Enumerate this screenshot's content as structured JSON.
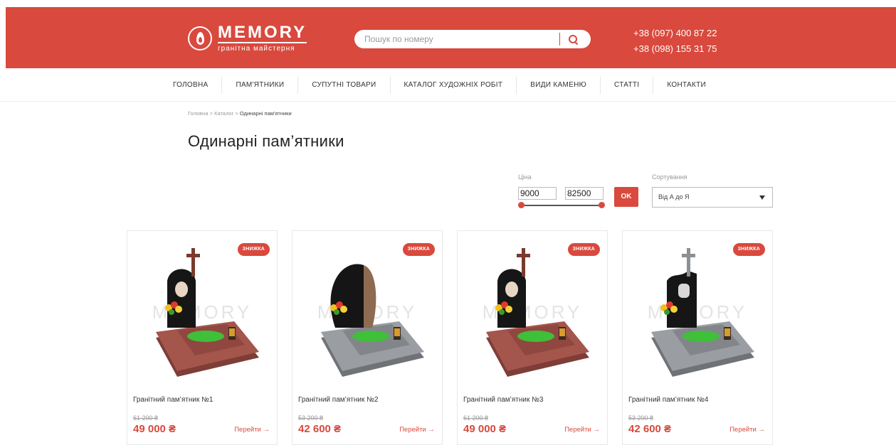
{
  "header": {
    "logo_name": "MEMORY",
    "logo_sub": "гранітна майстерня",
    "search_placeholder": "Пошук по номеру",
    "phones": [
      "+38 (097) 400 87 22",
      "+38 (098) 155 31 75"
    ]
  },
  "nav": [
    "ГОЛОВНА",
    "ПАМ'ЯТНИКИ",
    "СУПУТНІ ТОВАРИ",
    "КАТАЛОГ ХУДОЖНІХ РОБІТ",
    "ВИДИ КАМЕНЮ",
    "СТАТТІ",
    "КОНТАКТИ"
  ],
  "breadcrumb": {
    "items": [
      "Головна",
      "Каталог",
      "Одинарні пам'ятники"
    ],
    "separator": ">"
  },
  "page_title": "Одинарні пам’ятники",
  "filter": {
    "price_label": "Ціна",
    "price_min": "9000",
    "price_max": "82500",
    "ok_label": "OK",
    "sort_label": "Сортування",
    "sort_value": "Від А до Я"
  },
  "products": [
    {
      "title": "Гранітний пам’ятник №1",
      "badge": "ЗНИЖКА",
      "old_price": "61 200 ₴",
      "new_price": "49 000 ₴",
      "link": "Перейти →",
      "style": "red-cross"
    },
    {
      "title": "Гранітний пам’ятник №2",
      "badge": "ЗНИЖКА",
      "old_price": "53 200 ₴",
      "new_price": "42 600 ₴",
      "link": "Перейти →",
      "style": "grey-wave"
    },
    {
      "title": "Гранітний пам’ятник №3",
      "badge": "ЗНИЖКА",
      "old_price": "61 200 ₴",
      "new_price": "49 000 ₴",
      "link": "Перейти →",
      "style": "red-cross"
    },
    {
      "title": "Гранітний пам’ятник №4",
      "badge": "ЗНИЖКА",
      "old_price": "53 200 ₴",
      "new_price": "42 600 ₴",
      "link": "Перейти →",
      "style": "grey-cross"
    }
  ],
  "colors": {
    "accent": "#d9493d",
    "text": "#333333",
    "muted": "#999999"
  }
}
